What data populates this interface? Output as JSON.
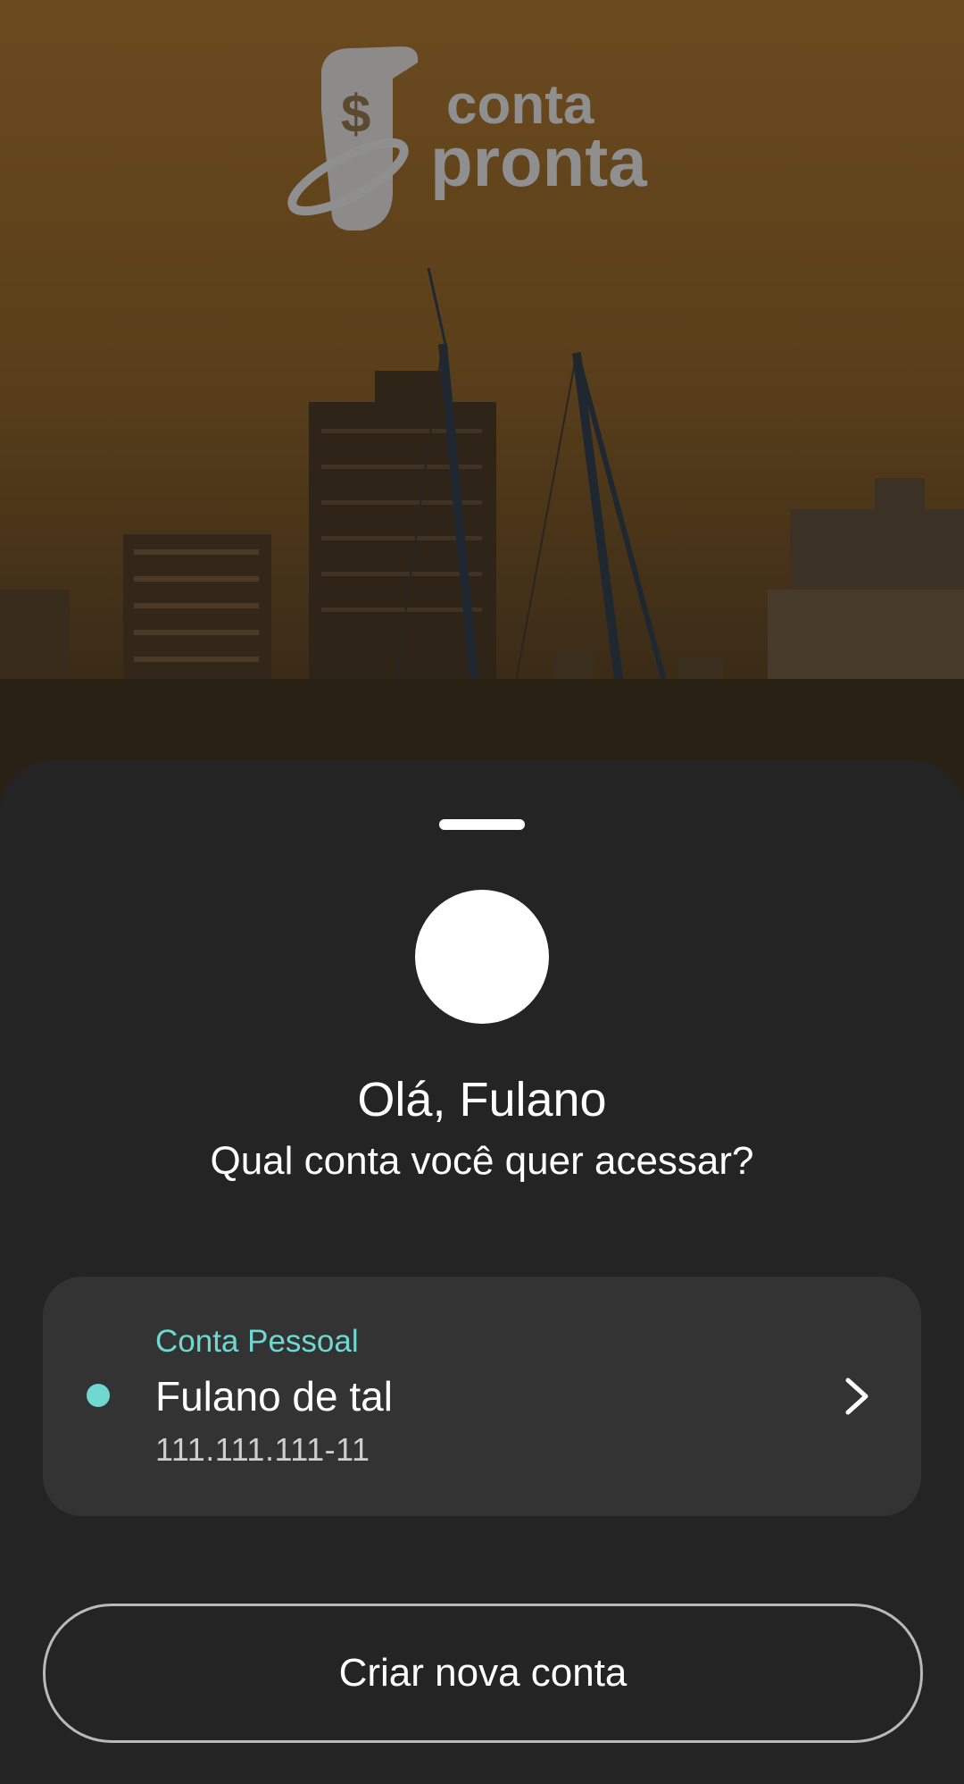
{
  "background": {
    "image": "city-skyline-sunset-photo",
    "sky_color_top": "#6a4a20",
    "sky_color_bottom": "#3d2c14"
  },
  "logo": {
    "icon": "receipt-dollar-icon",
    "line1": "conta",
    "line2": "pronta",
    "color": "#8f8f8f"
  },
  "sheet": {
    "greeting": "Olá, Fulano",
    "question": "Qual conta você quer acessar?"
  },
  "accounts": [
    {
      "type": "Conta Pessoal",
      "name": "Fulano de tal",
      "document": "111.111.111-11",
      "status_color": "#6fd8d0"
    }
  ],
  "actions": {
    "create_account": "Criar nova conta"
  },
  "colors": {
    "sheet_bg": "#242424",
    "card_bg": "#333333",
    "accent": "#6fd8d0"
  }
}
